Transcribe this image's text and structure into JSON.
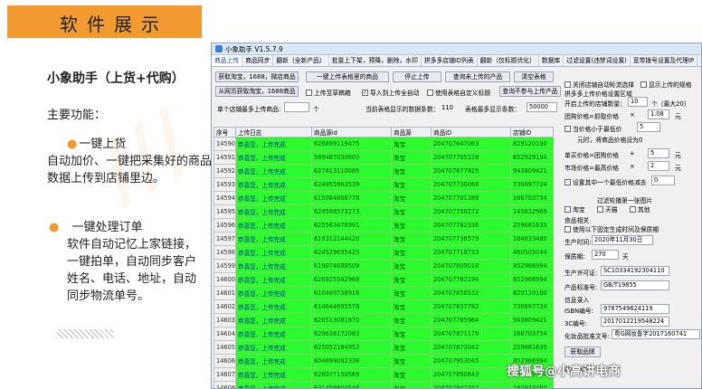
{
  "slide": {
    "header_title": "软件展示",
    "heading": "小象助手（上货+代购）",
    "subheading": "主要功能：",
    "feature1_title": "一键上货",
    "feature1_body": "自动加价、一键把采集好的商品数据上传到店铺里边。",
    "feature2_title": "一键处理订单",
    "feature2_body": "软件自动记忆上家链接，一键拍单，自动同步客户姓名、电话、地址，自动同步物流单号。",
    "accent_color": "#f09a30",
    "watermark": "搜狐号@小高讲电商"
  },
  "app": {
    "title": "小象助手 V1.5.7.9",
    "tabs": [
      "商品上传",
      "商品同步",
      "翻新（全新产品）",
      "批量上下架，预降，删除，水印",
      "拼多多店铺ID列表",
      "翻新（仅标题优化）",
      "数据库",
      "过滤设置(违禁词设置)",
      "宽带拨号设置及代理IP"
    ],
    "buttons": {
      "fetch_goods": "获取淘宝，1688，微店商品",
      "upload_table": "一键上传表格里的商品",
      "stop_upload": "停止上传",
      "query_uploaded": "查询未上传的产品",
      "clear_table": "清空表格",
      "fetch_page": "从网页获取淘宝，1688商品",
      "query_nonmatch": "查询不参与上传产品",
      "get_product": "获取品牌"
    },
    "checks": {
      "to_draft": "上传至草稿箱",
      "auto_next": "导入到上传全自动",
      "custom_tag": "使用表格自定义标题"
    },
    "store_limit_label": "单个店铺最多上传商品:",
    "store_limit_unit": "个",
    "current_count_label": "当前表格显示的数据条数：",
    "current_count_value": "110",
    "max_rows_label": "表格最多显示条数：",
    "max_rows_value": "50000",
    "columns": [
      "序号",
      "上传日志",
      "商品源id",
      "商品源",
      "商品ID",
      "店铺ID"
    ],
    "rows": [
      [
        "14590",
        "恭喜您，上传完成",
        "626899119475",
        "淘宝",
        "204707647063",
        "829120190"
      ],
      [
        "14591",
        "恭喜您，上传完成",
        "589487030803",
        "淘宝",
        "204707705128",
        "652929194"
      ],
      [
        "14592",
        "恭喜您，上传完成",
        "627813110089",
        "淘宝",
        "204707677925",
        "943809421"
      ],
      [
        "14593",
        "恭喜您，上传完成",
        "624955963539",
        "淘宝",
        "204707730068",
        "730697724"
      ],
      [
        "14594",
        "恭喜您，上传完成",
        "615084868778",
        "淘宝",
        "204707701388",
        "166703754"
      ],
      [
        "14595",
        "恭喜您，上传完成",
        "624568573273",
        "淘宝",
        "204707750272",
        "145832969"
      ],
      [
        "14596",
        "恭喜您，上传完成",
        "625563476991",
        "淘宝",
        "204707782336",
        "259681635"
      ],
      [
        "14597",
        "恭喜您，上传完成",
        "619312144420",
        "淘宝",
        "204707738579",
        "184833480"
      ],
      [
        "14598",
        "恭喜您，上传完成",
        "624529695425",
        "淘宝",
        "204707719733",
        "460505044"
      ],
      [
        "14599",
        "恭喜您，上传完成",
        "619074688509",
        "淘宝",
        "204707809018",
        "852966994"
      ],
      [
        "14600",
        "恭喜您，上传完成",
        "626925582968",
        "淘宝",
        "204707782194",
        "852966994"
      ],
      [
        "14601",
        "恭喜您，上传完成",
        "610469758916",
        "淘宝",
        "204707850532",
        "829120190"
      ],
      [
        "14602",
        "恭喜您，上传完成",
        "614644695578",
        "淘宝",
        "204707837782",
        "730697724"
      ],
      [
        "14603",
        "恭喜您，上传完成",
        "626513081870",
        "淘宝",
        "204707785964",
        "943809421"
      ],
      [
        "14604",
        "恭喜您，上传完成",
        "629638172083",
        "淘宝",
        "204707871179",
        "166703754"
      ],
      [
        "14605",
        "恭喜您，上传完成",
        "625052184952",
        "淘宝",
        "204707873042",
        "259681635"
      ],
      [
        "14606",
        "恭喜您，上传完成",
        "604899092338",
        "淘宝",
        "204707953045",
        "852966994"
      ],
      [
        "14607",
        "恭喜您，上传完成",
        "628077150569",
        "淘宝",
        "204707890843",
        "652929194"
      ],
      [
        "14608",
        "恭喜您，上传完成",
        "631458844546",
        "淘宝",
        "204707942257",
        "184833480"
      ]
    ],
    "right_panel": {
      "close_auto": "关闭店铺自动轮流选择",
      "show_spec": "显示上传的规格",
      "section_title": "拼多多上传价格设置区域",
      "open_limit_label": "开启上传的店铺数量：",
      "open_limit_value": "10",
      "open_limit_note": "个（最大20）",
      "group_price_label": "团购价格=抓取价格",
      "group_price_op": "×",
      "group_price_value": "1.08",
      "group_price_unit": "元",
      "min_price_label": "当价格小于最低价",
      "min_price_value": "5",
      "min_price_note": "元时，将商品价格设为0",
      "single_price_label": "单买价格=团购价格",
      "single_price_op": "+",
      "single_price_value": "5",
      "single_price_unit": "元",
      "market_price_label": "市场价格=最高价格",
      "market_price_op": "×",
      "market_price_value": "2",
      "market_price_unit": "元",
      "set_discount_label": "设置其中一个最低价格减去",
      "set_discount_value": "0",
      "filter_title": "过滤轮播第一张图片",
      "filter_taobao": "淘宝",
      "filter_tmall": "天猫",
      "filter_other": "其他",
      "goods_title": "食品相关",
      "goods_check": "使用以下固定生成时间及保质期",
      "produce_date_label": "生产时间:",
      "produce_date_value": "2020年11月30日",
      "shelf_life_label": "保质期:",
      "shelf_life_value": "270",
      "shelf_life_unit": "天",
      "license_label": "生产许可证:",
      "license_value": "SC10334192304110",
      "standard_label": "产品标准号:",
      "standard_value": "GB/T19855",
      "info_label": "信息录入",
      "isbn_label": "ISBN编号:",
      "isbn_value": "9787549624119",
      "code3c_label": "3C编号:",
      "code3c_value": "2017012219548224",
      "cosmetics_label": "化妆品批准文号:",
      "cosmetics_value": "粤G网妆备字2017160741",
      "bottom_text": "此区域用于快速查询"
    }
  }
}
